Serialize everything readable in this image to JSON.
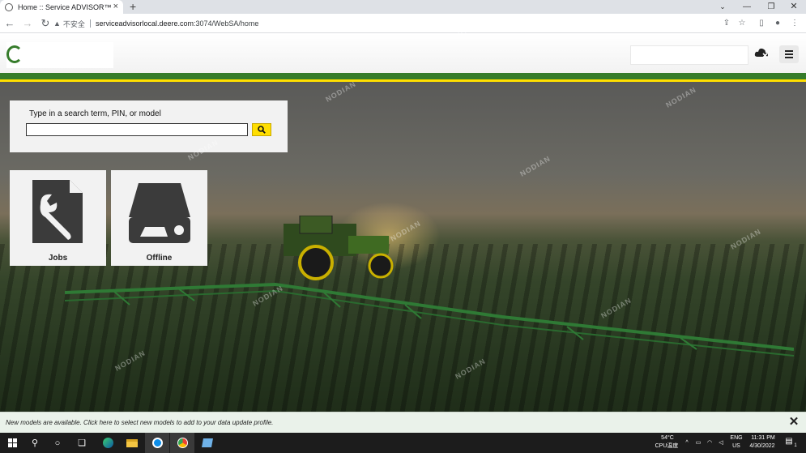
{
  "browser": {
    "tab_title": "Home :: Service ADVISOR™",
    "tab_close": "×",
    "new_tab": "+",
    "insecure_label": "不安全",
    "url_host": "serviceadvisorlocal.deere.com",
    "url_path": ":3074/WebSA/home"
  },
  "search": {
    "label": "Type in a search term, PIN, or model",
    "value": "",
    "placeholder": ""
  },
  "tiles": {
    "jobs_label": "Jobs",
    "offline_label": "Offline"
  },
  "notification": {
    "text": "New models are available. Click here to select new models to add to your data update profile."
  },
  "taskbar": {
    "temperature": "54°C",
    "cpu_label": "CPU温度",
    "lang": "ENG",
    "region": "US",
    "time": "11:31 PM",
    "date": "4/30/2022",
    "notif_count": "1"
  },
  "watermark": "NODIAN",
  "colors": {
    "deere_green": "#367c2b",
    "deere_yellow": "#ffde00"
  }
}
